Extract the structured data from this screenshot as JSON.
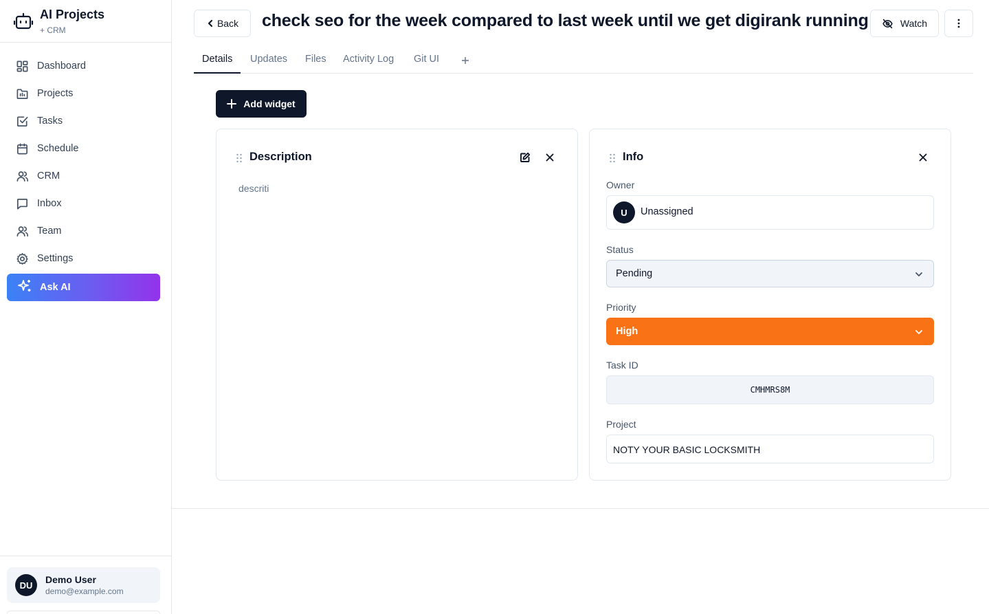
{
  "brand": {
    "title": "AI Projects",
    "subtitle": "+ CRM",
    "icon": "robot-icon"
  },
  "sidebar": {
    "items": [
      {
        "label": "Dashboard",
        "icon": "dashboard-icon"
      },
      {
        "label": "Projects",
        "icon": "folder-icon"
      },
      {
        "label": "Tasks",
        "icon": "checkbox-icon"
      },
      {
        "label": "Schedule",
        "icon": "calendar-icon"
      },
      {
        "label": "CRM",
        "icon": "users-icon"
      },
      {
        "label": "Inbox",
        "icon": "message-icon"
      },
      {
        "label": "Team",
        "icon": "team-icon"
      },
      {
        "label": "Settings",
        "icon": "gear-icon"
      }
    ],
    "ask_ai": {
      "label": "Ask AI",
      "icon": "sparkles-icon"
    }
  },
  "user": {
    "initials": "DU",
    "name": "Demo User",
    "email": "demo@example.com"
  },
  "header": {
    "back_label": "Back",
    "title": "check seo for the week compared to last week until we get digirank running",
    "watch_label": "Watch"
  },
  "tabs": [
    {
      "label": "Details",
      "active": true
    },
    {
      "label": "Updates",
      "active": false
    },
    {
      "label": "Files",
      "active": false
    },
    {
      "label": "Activity Log",
      "active": false
    },
    {
      "label": "Git UI",
      "active": false
    }
  ],
  "toolbar": {
    "add_widget_label": "Add widget"
  },
  "description_widget": {
    "title": "Description",
    "text": "descriti"
  },
  "info_widget": {
    "title": "Info",
    "owner": {
      "label": "Owner",
      "initial": "U",
      "value": "Unassigned"
    },
    "status": {
      "label": "Status",
      "value": "Pending"
    },
    "priority": {
      "label": "Priority",
      "value": "High",
      "color": "#f97316"
    },
    "task_id": {
      "label": "Task ID",
      "value": "CMHMRS8M"
    },
    "project": {
      "label": "Project",
      "value": "NOTY YOUR BASIC LOCKSMITH"
    }
  },
  "colors": {
    "primary": "#0f172a",
    "accent_gradient_start": "#3b82f6",
    "accent_gradient_end": "#9333ea",
    "priority_high": "#f97316"
  }
}
